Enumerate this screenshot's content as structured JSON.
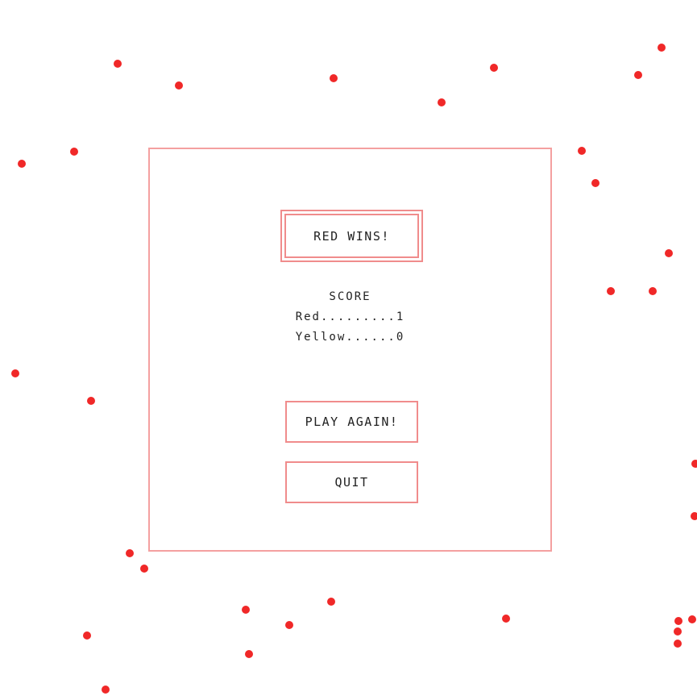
{
  "game": {
    "winner_text": "RED WINS!",
    "score": {
      "heading": "SCORE",
      "red_line": "Red.........1",
      "yellow_line": "Yellow......0",
      "red": 1,
      "yellow": 0
    },
    "play_again_label": "PLAY AGAIN!",
    "quit_label": "QUIT"
  },
  "colors": {
    "dot": "#f02828",
    "panel_border": "#f4a0a0",
    "button_border": "#f08c8c",
    "text": "#222222",
    "background": "#ffffff"
  }
}
